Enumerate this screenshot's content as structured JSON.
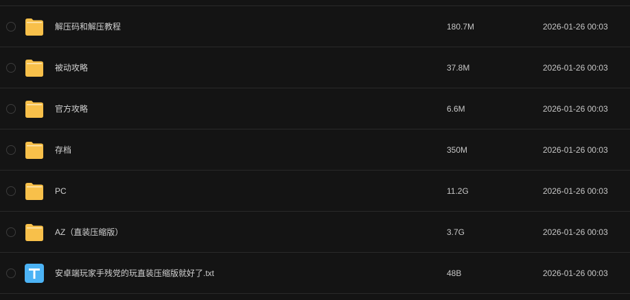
{
  "colors": {
    "background": "#141414",
    "divider": "#2a2a2a",
    "folder": "#f8c04a",
    "text_file": "#4cb3f5"
  },
  "files": [
    {
      "name": "解压码和解压教程",
      "size": "180.7M",
      "date": "2026-01-26 00:03",
      "icon": "folder-icon"
    },
    {
      "name": "被动攻略",
      "size": "37.8M",
      "date": "2026-01-26 00:03",
      "icon": "folder-icon"
    },
    {
      "name": "官方攻略",
      "size": "6.6M",
      "date": "2026-01-26 00:03",
      "icon": "folder-icon"
    },
    {
      "name": "存档",
      "size": "350M",
      "date": "2026-01-26 00:03",
      "icon": "folder-icon"
    },
    {
      "name": "PC",
      "size": "11.2G",
      "date": "2026-01-26 00:03",
      "icon": "folder-icon"
    },
    {
      "name": "AZ（直装压缩版）",
      "size": "3.7G",
      "date": "2026-01-26 00:03",
      "icon": "folder-icon"
    },
    {
      "name": "安卓端玩家手残党的玩直装压缩版就好了.txt",
      "size": "48B",
      "date": "2026-01-26 00:03",
      "icon": "text-file-icon"
    }
  ]
}
